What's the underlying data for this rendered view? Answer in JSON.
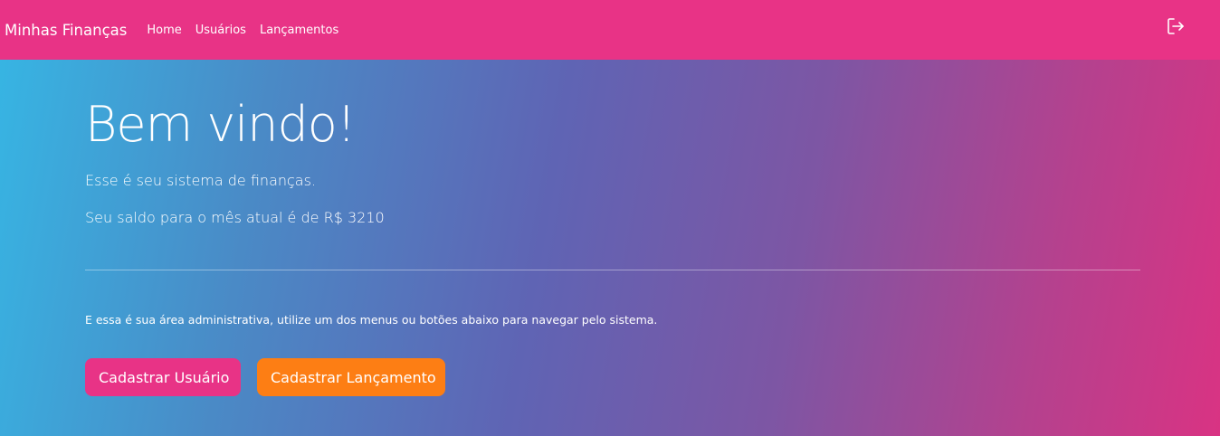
{
  "navbar": {
    "brand": "Minhas Finanças",
    "links": [
      "Home",
      "Usuários",
      "Lançamentos"
    ],
    "logout_icon": "logout-icon"
  },
  "hero": {
    "title": "Bem vindo!",
    "subtitle": "Esse é seu sistema de finanças.",
    "balance_text": "Seu saldo para o mês atual é de R$ 3210",
    "admin_text": "E essa é sua área administrativa, utilize um dos menus ou botões abaixo para navegar pelo sistema.",
    "buttons": {
      "register_user": "Cadastrar Usuário",
      "register_launch": "Cadastrar Lançamento"
    }
  },
  "colors": {
    "primary": "#e83386",
    "warning": "#fd7e14",
    "gradient_start": "#36b6e4",
    "gradient_end": "#d93383"
  }
}
